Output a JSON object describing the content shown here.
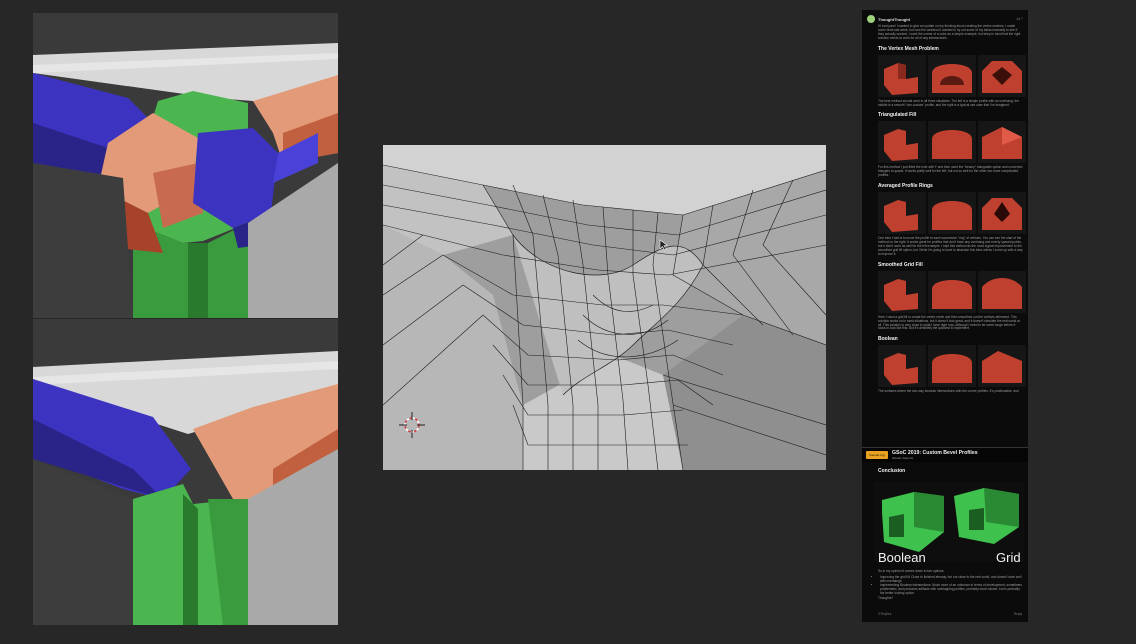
{
  "post": {
    "author": "ThoughtThought",
    "date": "Jul 7",
    "intro": "Hi everyone! I wanted to give an update on my thinking about creating the vertex meshes. I made some tests last week, but now the weekend I wanted to try out some of my ideas manually to see if they actually worked. I used the corner of a cube as a simple example, but keep in mind that the right solution needs to work for all of any intersections.",
    "sections": [
      {
        "heading": "The Vertex Mesh Problem",
        "text": "The best method should work in all three situations. The left is a simple profile with an overhang, the middle is a smooth \"non-custom\" profile, and the right is a typical use case that I've imagined."
      },
      {
        "heading": "Triangulated Fill",
        "text": "For this method I just filled the hole with F and then used the \"beauty\" triangulate option and converted triangles to quads. It works pretty well for the left, but not so well for the other two more complicated profiles."
      },
      {
        "heading": "Averaged Profile Rings",
        "text": "One idea I had is to move the profile to each successive \"ring\" of vertices. You can see the start of the method on the right. It works great for profiles that don't have any overhang and evenly spaced points, but it didn't work as well for the left example. I kept this method as the most logical improvement to the smoothed grid fill option, but I think I'm going to have to abandon this idea unless I come up with a way to improve it."
      },
      {
        "heading": "Smoothed Grid Fill",
        "text": "Here I used a grid fill to create the vertex mesh and then smoothed out the vertices afterward. This solution works on in most situations, but it doesn't look great, and it doesn't simulate the real world at all. This solution is very close to what I have right now, although I need to be some tough before it looks to look like this. But it's definitely the quickest to implement."
      },
      {
        "heading": "Boolean",
        "text": "The surfaces where the two-way boolean intersections with the corner profiles. It's positionable, and"
      }
    ],
    "banner": {
      "logo": "blender.org",
      "title": "GSoC 2019: Custom Bevel Profiles",
      "subtitle": "Weekly Reports"
    },
    "conclusion": {
      "heading": "Conclusion",
      "labels": {
        "left": "Boolean",
        "right": "Grid"
      },
      "intro": "So in my opinion it comes down to two options:",
      "options": [
        "Improving the grid fill: Close to finished already, but not close to the real world, and doesn't work well with overhangs.",
        "Implementing Boolean intersections: Much more of an unknown in terms of development, sometimes problematic, and produces artifacts with overlapping profiles, probably much slower, but is probably the better looking option."
      ],
      "closing": "Thoughts?"
    },
    "footer": {
      "left": "3 Replies",
      "right": "Reply"
    }
  },
  "colors": {
    "background": "#272727",
    "blue": "#3c33c0",
    "green": "#43b04a",
    "salmon": "#e39a78",
    "red_profile": "#c0402f",
    "mesh_green": "#3fc24d"
  }
}
